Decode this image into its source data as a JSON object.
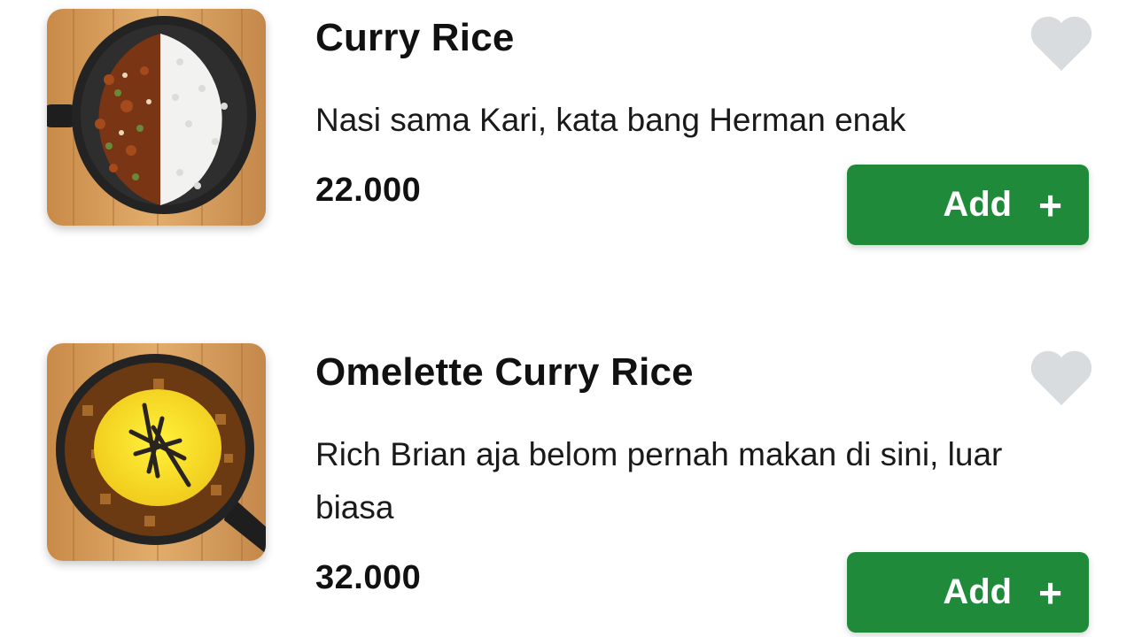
{
  "menu": {
    "items": [
      {
        "name": "Curry Rice",
        "description": "Nasi sama Kari, kata bang Herman enak",
        "price": "22.000",
        "add_label": "Add",
        "add_icon": "+",
        "image_icon": "curry-rice-image",
        "favorite_icon": "heart-icon"
      },
      {
        "name": "Omelette Curry Rice",
        "description": "Rich Brian aja belom pernah makan di sini, luar biasa",
        "price": "32.000",
        "add_label": "Add",
        "add_icon": "+",
        "image_icon": "omelette-curry-rice-image",
        "favorite_icon": "heart-icon"
      }
    ]
  },
  "colors": {
    "add_button": "#1f8a3a",
    "heart": "#d9dcde",
    "text": "#111111"
  }
}
